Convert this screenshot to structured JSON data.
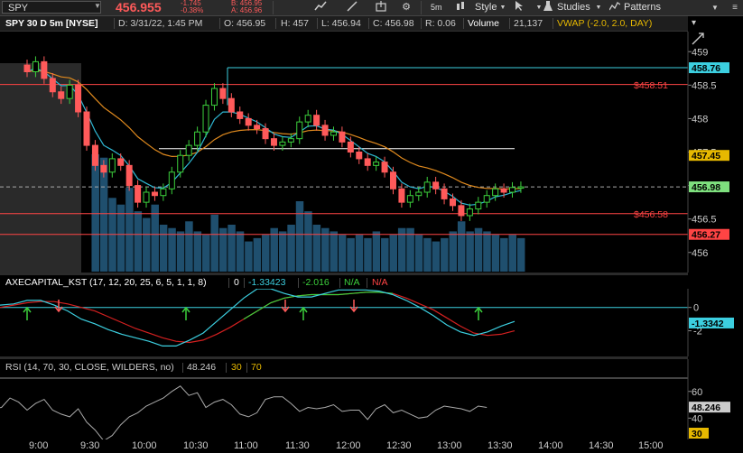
{
  "toolbar": {
    "symbol": "SPY",
    "last_price": "456.955",
    "change": "-1.745",
    "change_pct": "-0.38%",
    "bid": "B: 456.95",
    "ask": "A: 456.96",
    "timeframe": "5m",
    "style_label": "Style",
    "studies_label": "Studies",
    "patterns_label": "Patterns"
  },
  "header": {
    "title": "SPY 30 D 5m [NYSE]",
    "date": "D: 3/31/22, 1:45 PM",
    "open": "O: 456.95",
    "high": "H: 457",
    "low": "L: 456.94",
    "close": "C: 456.98",
    "range": "R: 0.06",
    "volume_label": "Volume",
    "volume_value": "21,137",
    "vwap": "VWAP (-2.0, 2.0, DAY)"
  },
  "price_panel": {
    "axis_ticks": [
      "459",
      "458.5",
      "458",
      "457.5",
      "457",
      "456.5",
      "456"
    ],
    "line_labels": {
      "upper": "$458.51",
      "lower": "$456.58"
    },
    "tags": [
      {
        "text": "458.76",
        "color": "#3ccfe0"
      },
      {
        "text": "457.45",
        "color": "#e6b800"
      },
      {
        "text": "456.98",
        "color": "#7ee07e"
      },
      {
        "text": "456.27",
        "color": "#ff4444"
      }
    ]
  },
  "kst_panel": {
    "name": "AXECAPITAL_KST (17, 12, 20, 25, 6, 5, 1, 1, 8)",
    "zero": "0",
    "kst_value": "-1.33423",
    "signal_value": "-2.016",
    "na1": "N/A",
    "na2": "N/A",
    "axis_ticks": [
      "0",
      "-2"
    ],
    "tag": "-1.3342"
  },
  "rsi_panel": {
    "name": "RSI (14, 70, 30, CLOSE, WILDERS, no)",
    "value": "48.246",
    "lower": "30",
    "upper": "70",
    "axis_ticks": [
      "60",
      "40"
    ],
    "tag_value": "48.246",
    "tag_low": "30"
  },
  "time_axis": [
    "9:00",
    "9:30",
    "10:00",
    "10:30",
    "11:00",
    "11:30",
    "12:00",
    "12:30",
    "13:00",
    "13:30",
    "14:00",
    "14:30",
    "15:00"
  ],
  "chart_data": {
    "type": "line",
    "title": "SPY 30 D 5m [NYSE]",
    "xlabel": "",
    "ylabel": "",
    "x": [
      "8:55",
      "9:00",
      "9:05",
      "9:10",
      "9:15",
      "9:20",
      "9:25",
      "9:30",
      "9:35",
      "9:40",
      "9:45",
      "9:50",
      "9:55",
      "10:00",
      "10:05",
      "10:10",
      "10:15",
      "10:20",
      "10:25",
      "10:30",
      "10:35",
      "10:40",
      "10:45",
      "10:50",
      "10:55",
      "11:00",
      "11:05",
      "11:10",
      "11:15",
      "11:20",
      "11:25",
      "11:30",
      "11:35",
      "11:40",
      "11:45",
      "11:50",
      "11:55",
      "12:00",
      "12:05",
      "12:10",
      "12:15",
      "12:20",
      "12:25",
      "12:30",
      "12:35",
      "12:40",
      "12:45",
      "12:50",
      "12:55",
      "13:00",
      "13:05",
      "13:10",
      "13:15",
      "13:20",
      "13:25",
      "13:30",
      "13:35",
      "13:40",
      "13:45"
    ],
    "series": [
      {
        "name": "",
        "values": [
          458.7,
          458.85,
          458.6,
          458.4,
          458.3,
          458.5,
          458.1,
          457.6,
          457.3,
          457.2,
          457.4,
          457.3,
          457.0,
          456.75,
          456.9,
          456.85,
          456.95,
          457.2,
          457.45,
          457.6,
          457.8,
          458.2,
          458.45,
          458.3,
          458.1,
          458.0,
          457.9,
          457.85,
          457.7,
          457.6,
          457.65,
          457.7,
          457.95,
          458.05,
          457.9,
          457.75,
          457.8,
          457.65,
          457.5,
          457.4,
          457.3,
          457.35,
          457.2,
          456.95,
          456.75,
          456.85,
          456.9,
          457.05,
          456.95,
          456.8,
          456.7,
          456.55,
          456.65,
          456.75,
          456.85,
          456.95,
          456.9,
          456.97,
          456.98
        ]
      }
    ],
    "ylim": [
      455.7,
      459.3
    ],
    "volume": [
      null,
      null,
      null,
      null,
      null,
      null,
      null,
      null,
      70,
      68,
      44,
      40,
      50,
      36,
      32,
      40,
      28,
      26,
      24,
      30,
      24,
      22,
      34,
      26,
      28,
      24,
      18,
      20,
      22,
      26,
      24,
      28,
      42,
      36,
      28,
      26,
      24,
      22,
      20,
      22,
      20,
      24,
      20,
      22,
      26,
      26,
      22,
      20,
      18,
      20,
      24,
      30,
      24,
      26,
      24,
      22,
      20,
      22,
      20
    ],
    "kst": [
      0.2,
      0.3,
      0.6,
      0.6,
      0.2,
      -0.3,
      -1.0,
      -1.4,
      -1.9,
      -2.3,
      -2.6,
      -2.9,
      -3.3,
      -3.3,
      -2.8,
      -2.2,
      -1.2,
      -0.2,
      0.8,
      1.6,
      1.6,
      1.2,
      0.9,
      0.9,
      1.2,
      1.5,
      1.5,
      1.5,
      1.4,
      1.1,
      0.6,
      0.0,
      -0.7,
      -1.5,
      -2.1,
      -2.4,
      -2.1,
      -1.6,
      -1.2
    ],
    "kst_signal": [
      0.0,
      0.2,
      0.4,
      0.5,
      0.5,
      0.3,
      0.0,
      -0.3,
      -0.8,
      -1.3,
      -1.8,
      -2.2,
      -2.6,
      -2.9,
      -3.0,
      -2.8,
      -2.3,
      -1.7,
      -1.0,
      -0.3,
      0.4,
      0.8,
      1.0,
      1.1,
      1.1,
      1.1,
      1.2,
      1.3,
      1.3,
      1.2,
      0.8,
      0.3,
      -0.2,
      -0.9,
      -1.6,
      -2.2,
      -2.4,
      -2.3,
      -2.0
    ],
    "rsi": [
      47,
      48,
      55,
      52,
      46,
      51,
      54,
      46,
      43,
      41,
      47,
      37,
      31,
      23,
      27,
      35,
      41,
      44,
      49,
      52,
      55,
      60,
      64,
      57,
      59,
      48,
      52,
      54,
      50,
      43,
      41,
      44,
      54,
      56,
      56,
      51,
      45,
      48,
      47,
      48,
      50,
      45,
      46,
      46,
      39,
      47,
      50,
      44,
      46,
      43,
      40,
      41,
      46,
      49,
      48,
      47,
      45,
      49,
      48
    ]
  }
}
